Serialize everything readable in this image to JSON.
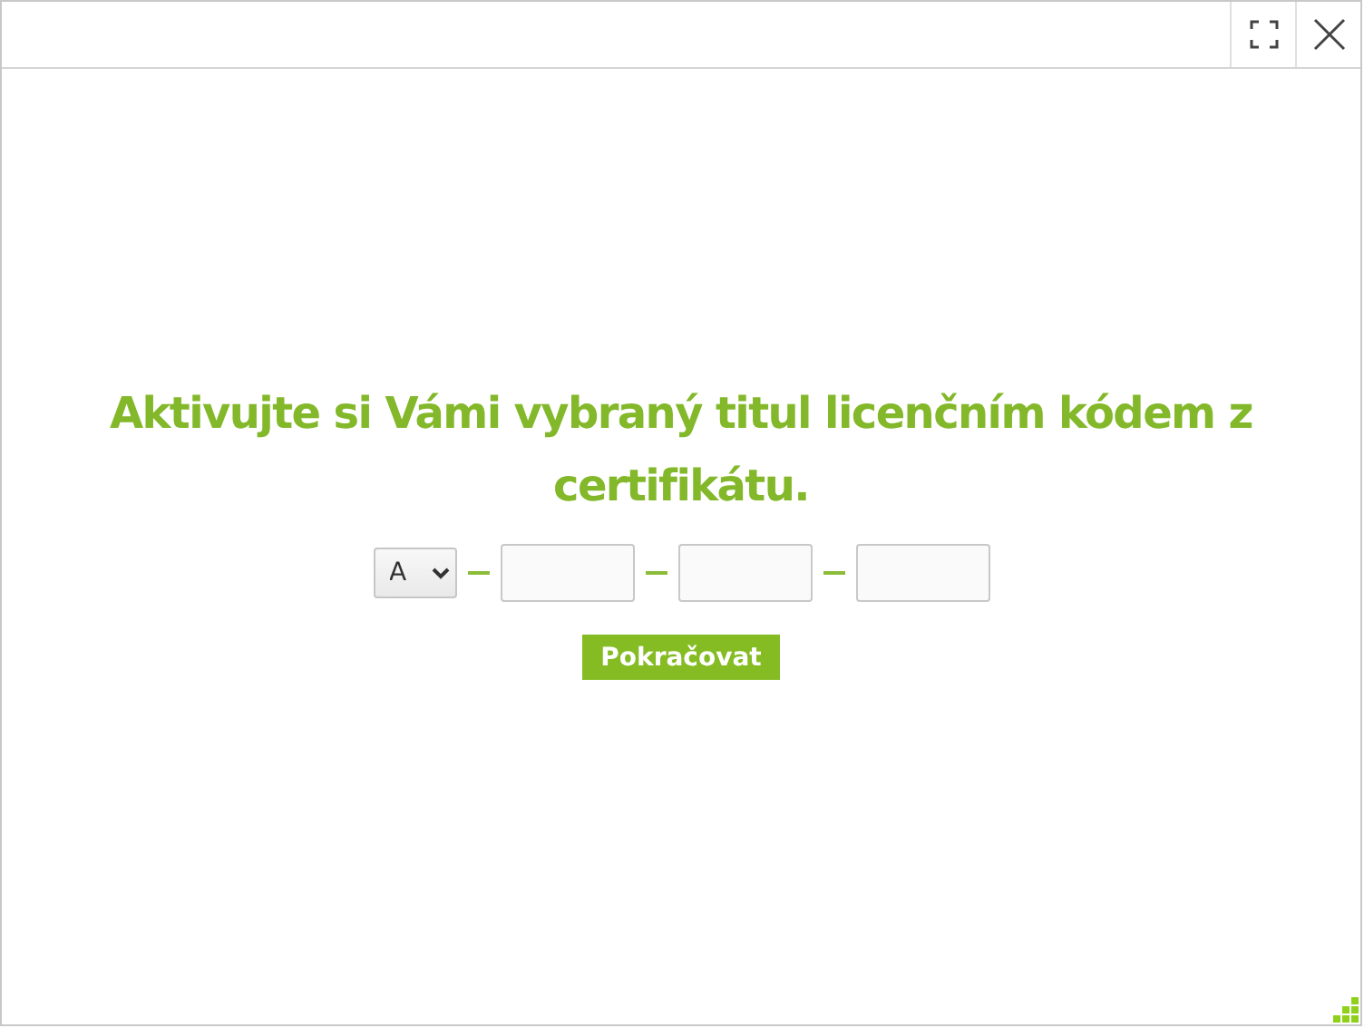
{
  "dialog": {
    "heading": "Aktivujte si Vámi vybraný titul licenčním kódem z certifikátu.",
    "code": {
      "prefix": "A",
      "fields": [
        {
          "kind": "text"
        },
        {
          "kind": "text"
        },
        {
          "kind": "text"
        }
      ]
    },
    "button": "Pokračovat"
  }
}
